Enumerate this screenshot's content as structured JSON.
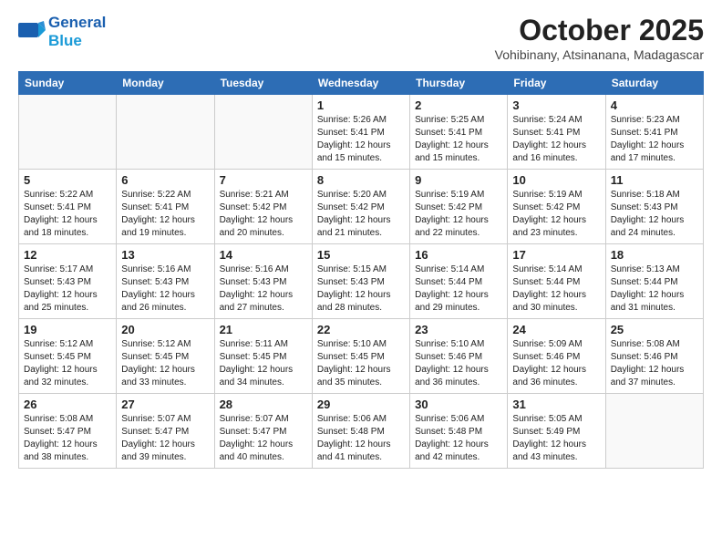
{
  "header": {
    "logo_line1": "General",
    "logo_line2": "Blue",
    "month": "October 2025",
    "location": "Vohibinany, Atsinanana, Madagascar"
  },
  "weekdays": [
    "Sunday",
    "Monday",
    "Tuesday",
    "Wednesday",
    "Thursday",
    "Friday",
    "Saturday"
  ],
  "weeks": [
    [
      {
        "day": "",
        "info": ""
      },
      {
        "day": "",
        "info": ""
      },
      {
        "day": "",
        "info": ""
      },
      {
        "day": "1",
        "info": "Sunrise: 5:26 AM\nSunset: 5:41 PM\nDaylight: 12 hours\nand 15 minutes."
      },
      {
        "day": "2",
        "info": "Sunrise: 5:25 AM\nSunset: 5:41 PM\nDaylight: 12 hours\nand 15 minutes."
      },
      {
        "day": "3",
        "info": "Sunrise: 5:24 AM\nSunset: 5:41 PM\nDaylight: 12 hours\nand 16 minutes."
      },
      {
        "day": "4",
        "info": "Sunrise: 5:23 AM\nSunset: 5:41 PM\nDaylight: 12 hours\nand 17 minutes."
      }
    ],
    [
      {
        "day": "5",
        "info": "Sunrise: 5:22 AM\nSunset: 5:41 PM\nDaylight: 12 hours\nand 18 minutes."
      },
      {
        "day": "6",
        "info": "Sunrise: 5:22 AM\nSunset: 5:41 PM\nDaylight: 12 hours\nand 19 minutes."
      },
      {
        "day": "7",
        "info": "Sunrise: 5:21 AM\nSunset: 5:42 PM\nDaylight: 12 hours\nand 20 minutes."
      },
      {
        "day": "8",
        "info": "Sunrise: 5:20 AM\nSunset: 5:42 PM\nDaylight: 12 hours\nand 21 minutes."
      },
      {
        "day": "9",
        "info": "Sunrise: 5:19 AM\nSunset: 5:42 PM\nDaylight: 12 hours\nand 22 minutes."
      },
      {
        "day": "10",
        "info": "Sunrise: 5:19 AM\nSunset: 5:42 PM\nDaylight: 12 hours\nand 23 minutes."
      },
      {
        "day": "11",
        "info": "Sunrise: 5:18 AM\nSunset: 5:43 PM\nDaylight: 12 hours\nand 24 minutes."
      }
    ],
    [
      {
        "day": "12",
        "info": "Sunrise: 5:17 AM\nSunset: 5:43 PM\nDaylight: 12 hours\nand 25 minutes."
      },
      {
        "day": "13",
        "info": "Sunrise: 5:16 AM\nSunset: 5:43 PM\nDaylight: 12 hours\nand 26 minutes."
      },
      {
        "day": "14",
        "info": "Sunrise: 5:16 AM\nSunset: 5:43 PM\nDaylight: 12 hours\nand 27 minutes."
      },
      {
        "day": "15",
        "info": "Sunrise: 5:15 AM\nSunset: 5:43 PM\nDaylight: 12 hours\nand 28 minutes."
      },
      {
        "day": "16",
        "info": "Sunrise: 5:14 AM\nSunset: 5:44 PM\nDaylight: 12 hours\nand 29 minutes."
      },
      {
        "day": "17",
        "info": "Sunrise: 5:14 AM\nSunset: 5:44 PM\nDaylight: 12 hours\nand 30 minutes."
      },
      {
        "day": "18",
        "info": "Sunrise: 5:13 AM\nSunset: 5:44 PM\nDaylight: 12 hours\nand 31 minutes."
      }
    ],
    [
      {
        "day": "19",
        "info": "Sunrise: 5:12 AM\nSunset: 5:45 PM\nDaylight: 12 hours\nand 32 minutes."
      },
      {
        "day": "20",
        "info": "Sunrise: 5:12 AM\nSunset: 5:45 PM\nDaylight: 12 hours\nand 33 minutes."
      },
      {
        "day": "21",
        "info": "Sunrise: 5:11 AM\nSunset: 5:45 PM\nDaylight: 12 hours\nand 34 minutes."
      },
      {
        "day": "22",
        "info": "Sunrise: 5:10 AM\nSunset: 5:45 PM\nDaylight: 12 hours\nand 35 minutes."
      },
      {
        "day": "23",
        "info": "Sunrise: 5:10 AM\nSunset: 5:46 PM\nDaylight: 12 hours\nand 36 minutes."
      },
      {
        "day": "24",
        "info": "Sunrise: 5:09 AM\nSunset: 5:46 PM\nDaylight: 12 hours\nand 36 minutes."
      },
      {
        "day": "25",
        "info": "Sunrise: 5:08 AM\nSunset: 5:46 PM\nDaylight: 12 hours\nand 37 minutes."
      }
    ],
    [
      {
        "day": "26",
        "info": "Sunrise: 5:08 AM\nSunset: 5:47 PM\nDaylight: 12 hours\nand 38 minutes."
      },
      {
        "day": "27",
        "info": "Sunrise: 5:07 AM\nSunset: 5:47 PM\nDaylight: 12 hours\nand 39 minutes."
      },
      {
        "day": "28",
        "info": "Sunrise: 5:07 AM\nSunset: 5:47 PM\nDaylight: 12 hours\nand 40 minutes."
      },
      {
        "day": "29",
        "info": "Sunrise: 5:06 AM\nSunset: 5:48 PM\nDaylight: 12 hours\nand 41 minutes."
      },
      {
        "day": "30",
        "info": "Sunrise: 5:06 AM\nSunset: 5:48 PM\nDaylight: 12 hours\nand 42 minutes."
      },
      {
        "day": "31",
        "info": "Sunrise: 5:05 AM\nSunset: 5:49 PM\nDaylight: 12 hours\nand 43 minutes."
      },
      {
        "day": "",
        "info": ""
      }
    ]
  ]
}
